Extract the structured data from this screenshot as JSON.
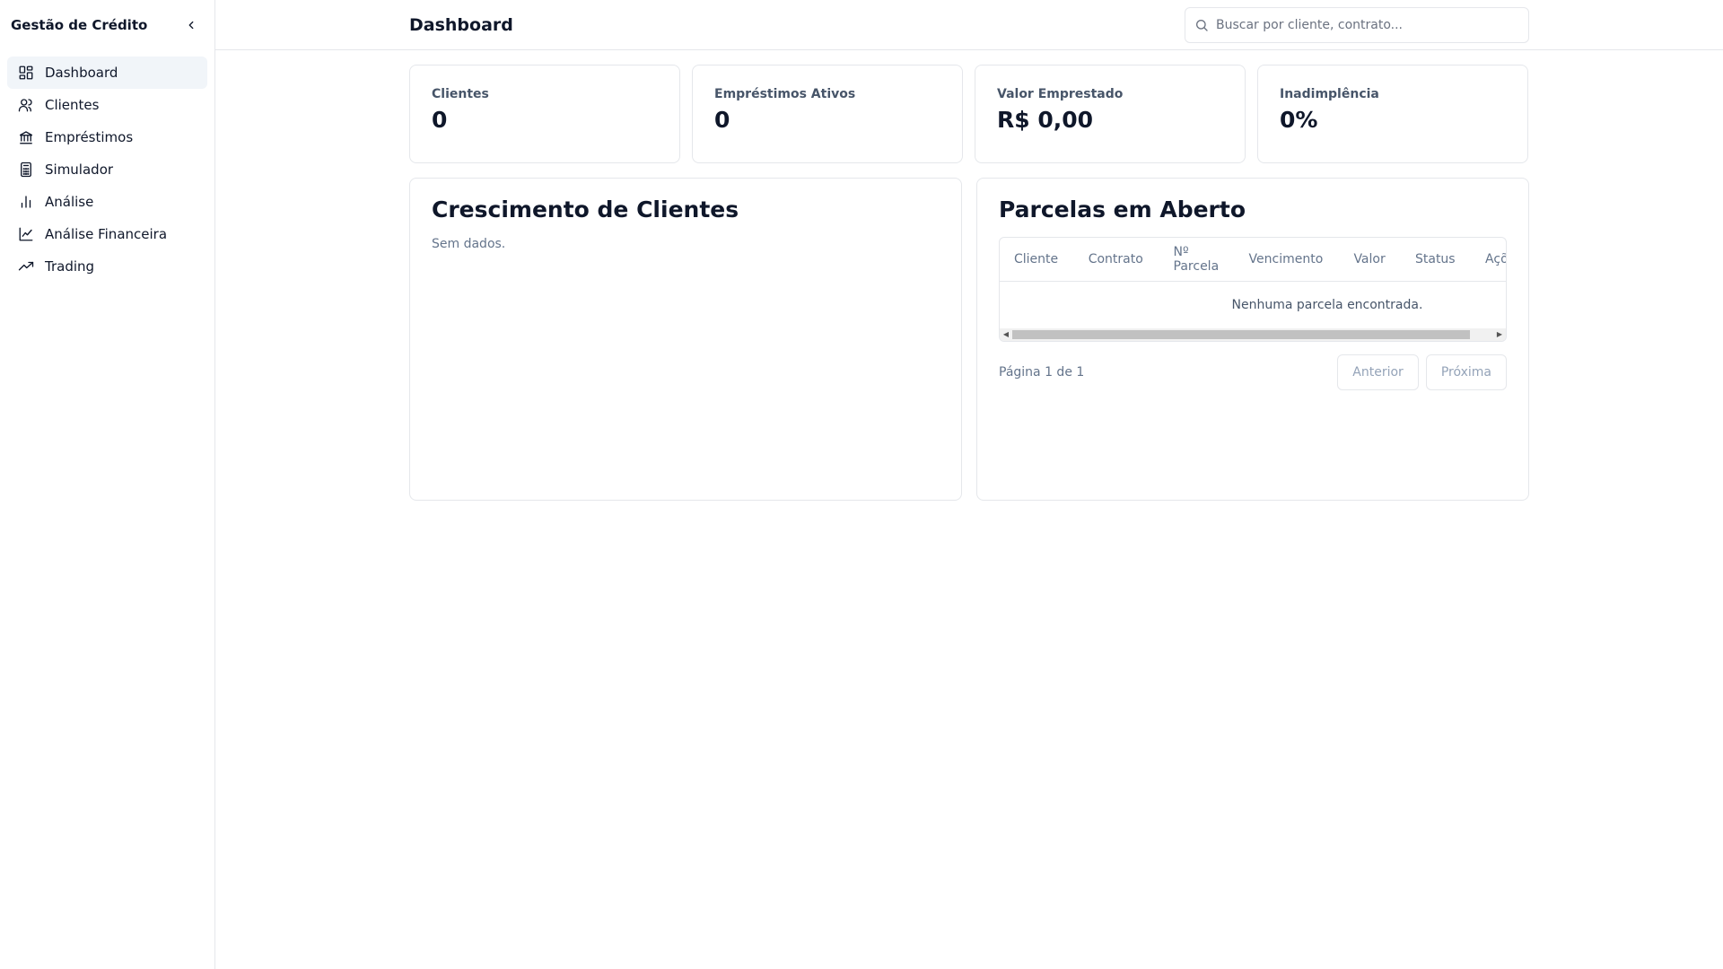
{
  "sidebar": {
    "brand": "Gestão de Crédito",
    "items": [
      {
        "label": "Dashboard",
        "icon": "dashboard-icon",
        "active": true
      },
      {
        "label": "Clientes",
        "icon": "users-icon"
      },
      {
        "label": "Empréstimos",
        "icon": "bank-icon"
      },
      {
        "label": "Simulador",
        "icon": "calculator-icon"
      },
      {
        "label": "Análise",
        "icon": "bar-chart-icon"
      },
      {
        "label": "Análise Financeira",
        "icon": "line-chart-icon"
      },
      {
        "label": "Trading",
        "icon": "trending-up-icon"
      }
    ]
  },
  "header": {
    "title": "Dashboard",
    "search_placeholder": "Buscar por cliente, contrato..."
  },
  "stats": [
    {
      "label": "Clientes",
      "value": "0"
    },
    {
      "label": "Empréstimos Ativos",
      "value": "0"
    },
    {
      "label": "Valor Emprestado",
      "value": "R$ 0,00"
    },
    {
      "label": "Inadimplência",
      "value": "0%"
    }
  ],
  "growth_panel": {
    "title": "Crescimento de Clientes",
    "empty": "Sem dados."
  },
  "installments_panel": {
    "title": "Parcelas em Aberto",
    "columns": [
      "Cliente",
      "Contrato",
      "Nº Parcela",
      "Vencimento",
      "Valor",
      "Status",
      "Ações"
    ],
    "empty": "Nenhuma parcela encontrada.",
    "page_info": "Página 1 de 1",
    "prev_label": "Anterior",
    "next_label": "Próxima"
  }
}
